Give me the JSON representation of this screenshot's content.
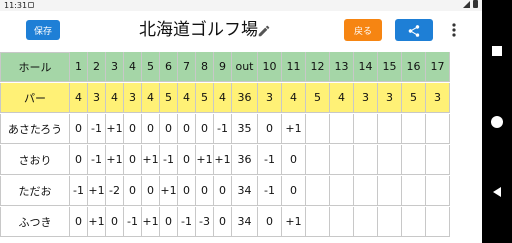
{
  "status": {
    "time": "11:31"
  },
  "toolbar": {
    "save_label": "保存",
    "title": "北海道ゴルフ場",
    "back_label": "戻る"
  },
  "table": {
    "header_label": "ホール",
    "holes_front": [
      "1",
      "2",
      "3",
      "4",
      "5",
      "6",
      "7",
      "8",
      "9"
    ],
    "out_label": "out",
    "holes_back": [
      "10",
      "11",
      "12",
      "13",
      "14",
      "15",
      "16",
      "17"
    ],
    "par_label": "パー",
    "par_front": [
      "4",
      "3",
      "4",
      "3",
      "4",
      "5",
      "4",
      "5",
      "4"
    ],
    "par_out": "36",
    "par_back": [
      "3",
      "4",
      "5",
      "4",
      "3",
      "3",
      "5",
      "3"
    ],
    "players": [
      {
        "name": "あさたろう",
        "front": [
          "0",
          "-1",
          "+1",
          "0",
          "0",
          "0",
          "0",
          "0",
          "-1"
        ],
        "out": "35",
        "back": [
          "0",
          "+1",
          "",
          "",
          "",
          "",
          "",
          ""
        ]
      },
      {
        "name": "さおり",
        "front": [
          "0",
          "-1",
          "+1",
          "0",
          "+1",
          "-1",
          "0",
          "+1",
          "+1"
        ],
        "out": "36",
        "back": [
          "-1",
          "0",
          "",
          "",
          "",
          "",
          "",
          ""
        ]
      },
      {
        "name": "ただお",
        "front": [
          "-1",
          "+1",
          "-2",
          "0",
          "0",
          "+1",
          "0",
          "0",
          "0"
        ],
        "out": "34",
        "back": [
          "-1",
          "0",
          "",
          "",
          "",
          "",
          "",
          ""
        ]
      },
      {
        "name": "ふつき",
        "front": [
          "0",
          "+1",
          "0",
          "-1",
          "+1",
          "0",
          "-1",
          "-3",
          "0"
        ],
        "out": "34",
        "back": [
          "0",
          "+1",
          "",
          "",
          "",
          "",
          "",
          ""
        ]
      }
    ]
  },
  "icons": {
    "pencil": "pencil-icon",
    "share": "share-icon",
    "menu": "more-vert-icon"
  },
  "colors": {
    "header_bg": "#a5d6a7",
    "par_bg": "#fff176",
    "primary": "#1e7fd6",
    "back_button": "#f68512"
  }
}
